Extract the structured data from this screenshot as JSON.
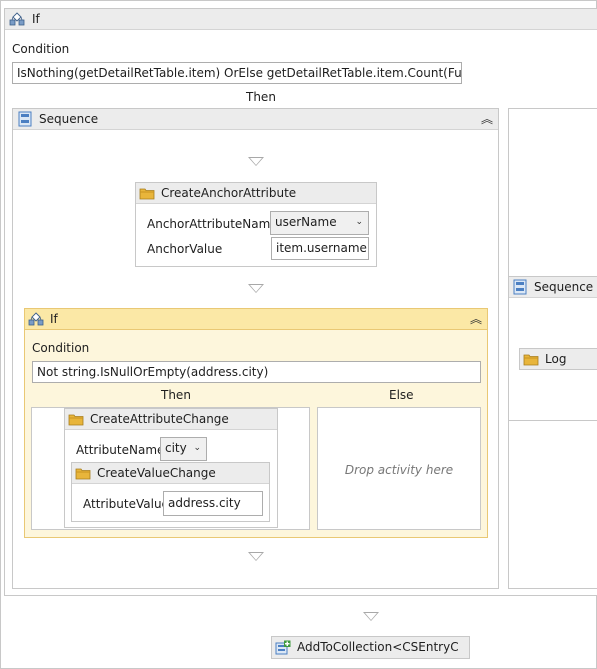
{
  "outer_if": {
    "title": "If",
    "condition_label": "Condition",
    "condition_value": "IsNothing(getDetailRetTable.item) OrElse getDetailRetTable.item.Count(Function(er",
    "then_label": "Then"
  },
  "sequence_main": {
    "title": "Sequence",
    "collapse_glyph": "︽"
  },
  "create_anchor": {
    "title": "CreateAnchorAttribute",
    "name_label": "AnchorAttributeName",
    "name_value": "userName",
    "value_label": "AnchorValue",
    "value_value": "item.username"
  },
  "inner_if": {
    "title": "If",
    "condition_label": "Condition",
    "condition_value": "Not string.IsNullOrEmpty(address.city)",
    "then_label": "Then",
    "else_label": "Else",
    "else_placeholder": "Drop activity here",
    "collapse_glyph": "︽"
  },
  "create_attr_change": {
    "title": "CreateAttributeChange",
    "name_label": "AttributeName",
    "name_value": "city"
  },
  "create_value_change": {
    "title": "CreateValueChange",
    "value_label": "AttributeValue",
    "value_value": "address.city"
  },
  "sequence_side": {
    "title": "Sequence",
    "log_title": "Log"
  },
  "add_to_collection": {
    "title": "AddToCollection<CSEntryC"
  },
  "colors": {
    "header_bg": "#ececec",
    "if_highlight_bg": "#fdf6dc",
    "if_highlight_border": "#e9c874",
    "folder_icon": "#e8b53b",
    "sequence_icon": "#4b7fc2"
  }
}
